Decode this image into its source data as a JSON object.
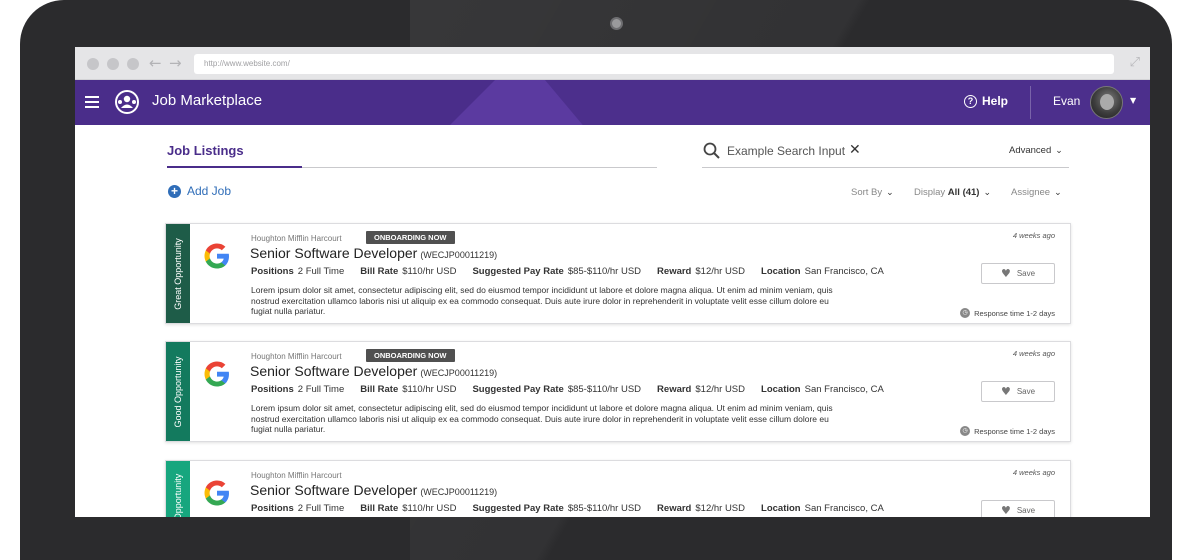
{
  "browser": {
    "url": "http://www.website.com/",
    "back_icon": "arrow-left-icon",
    "forward_icon": "arrow-right-icon",
    "expand_icon": "expand-icon"
  },
  "header": {
    "title": "Job Marketplace",
    "help_label": "Help",
    "user_name": "Evan",
    "brand_color": "#4a2d8a"
  },
  "tabs": {
    "active": "Job Listings"
  },
  "search": {
    "placeholder": "Example Search Input",
    "advanced_label": "Advanced"
  },
  "toolbar": {
    "add_label": "Add Job",
    "sort_label": "Sort By",
    "display_label": "Display",
    "display_value": "All (41)",
    "assignee_label": "Assignee"
  },
  "labels": {
    "positions": "Positions",
    "bill_rate": "Bill Rate",
    "suggested_pay": "Suggested Pay Rate",
    "reward": "Reward",
    "location": "Location",
    "save": "Save"
  },
  "jobs": [
    {
      "band": "Great Opportunity",
      "band_color": "#1e5c48",
      "company": "Houghton Mifflin Harcourt",
      "badge": "ONBOARDING NOW",
      "title": "Senior Software Developer",
      "job_id": "(WECJP00011219)",
      "positions": "2 Full Time",
      "bill_rate": "$110/hr USD",
      "suggested_pay": "$85-$110/hr USD",
      "reward": "$12/hr USD",
      "location": "San Francisco, CA",
      "posted": "4 weeks ago",
      "response": "Response time 1-2 days",
      "description": "Lorem ipsum dolor sit amet, consectetur adipiscing elit, sed do eiusmod tempor incididunt ut labore et dolore magna aliqua. Ut enim ad minim veniam, quis nostrud exercitation ullamco laboris nisi ut aliquip ex ea commodo consequat. Duis aute irure dolor in reprehenderit in voluptate velit esse cillum dolore eu fugiat nulla pariatur."
    },
    {
      "band": "Good Opportunity",
      "band_color": "#137a5e",
      "company": "Houghton Mifflin Harcourt",
      "badge": "ONBOARDING NOW",
      "title": "Senior Software Developer",
      "job_id": "(WECJP00011219)",
      "positions": "2 Full Time",
      "bill_rate": "$110/hr USD",
      "suggested_pay": "$85-$110/hr USD",
      "reward": "$12/hr USD",
      "location": "San Francisco, CA",
      "posted": "4 weeks ago",
      "response": "Response time 1-2 days",
      "description": "Lorem ipsum dolor sit amet, consectetur adipiscing elit, sed do eiusmod tempor incididunt ut labore et dolore magna aliqua. Ut enim ad minim veniam, quis nostrud exercitation ullamco laboris nisi ut aliquip ex ea commodo consequat. Duis aute irure dolor in reprehenderit in voluptate velit esse cillum dolore eu fugiat nulla pariatur."
    },
    {
      "band": "Opportunity",
      "band_color": "#17a67e",
      "company": "Houghton Mifflin Harcourt",
      "title": "Senior Software Developer",
      "job_id": "(WECJP00011219)",
      "positions": "2 Full Time",
      "bill_rate": "$110/hr USD",
      "suggested_pay": "$85-$110/hr USD",
      "reward": "$12/hr USD",
      "location": "San Francisco, CA",
      "posted": "4 weeks ago"
    }
  ]
}
